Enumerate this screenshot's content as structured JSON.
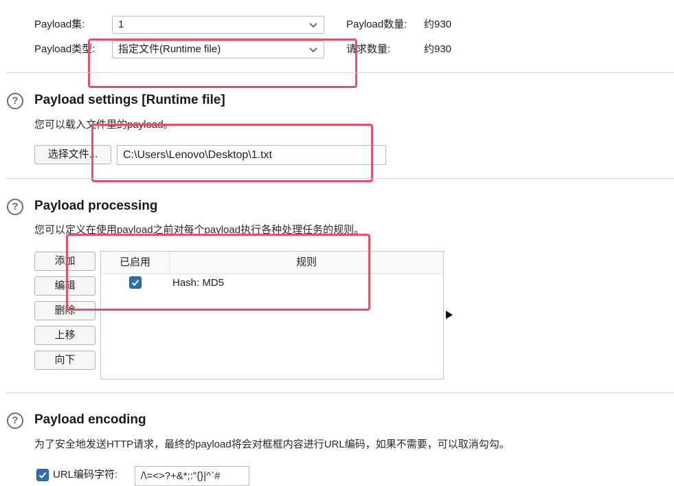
{
  "top": {
    "payload_set_label": "Payload集:",
    "payload_set_value": "1",
    "payload_type_label": "Payload类型:",
    "payload_type_value": "指定文件(Runtime file)",
    "payload_count_label": "Payload数量:",
    "payload_count_value": "约930",
    "request_count_label": "请求数量:",
    "request_count_value": "约930"
  },
  "settings": {
    "title": "Payload settings [Runtime file]",
    "description": "您可以载入文件里的payload。",
    "choose_file_label": "选择文件...",
    "file_path": "C:\\Users\\Lenovo\\Desktop\\1.txt"
  },
  "processing": {
    "title": "Payload processing",
    "description": "您可以定义在使用payload之前对每个payload执行各种处理任务的规则。",
    "buttons": [
      "添加",
      "编辑",
      "删除",
      "上移",
      "向下"
    ],
    "columns": [
      "已启用",
      "规则"
    ],
    "rows": [
      {
        "enabled": true,
        "rule": "Hash: MD5"
      }
    ]
  },
  "encoding": {
    "title": "Payload encoding",
    "description": "为了安全地发送HTTP请求，最终的payload将会对框框内容进行URL编码，如果不需要，可以取消勾勾。",
    "url_encode_label": "URL编码字符:",
    "url_encode_checked": true,
    "url_encode_chars": "/\\=<>?+&*;:\"{}|^`#"
  },
  "icons": {
    "help": "help-circle-icon",
    "dropdown": "chevron-down-icon",
    "check": "checkmark-icon",
    "expand": "triangle-right-icon"
  },
  "colors": {
    "highlight": "#e6506a",
    "checkbox": "#2c6fb0"
  }
}
